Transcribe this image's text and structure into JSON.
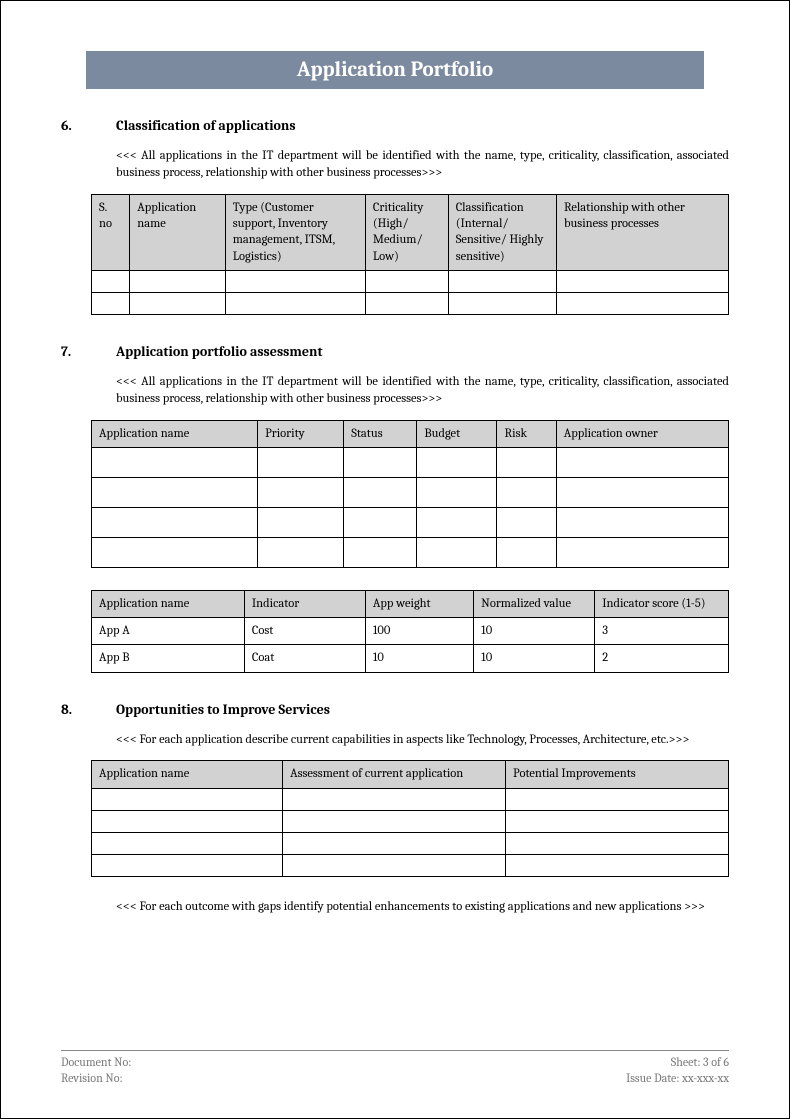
{
  "title": "Application Portfolio",
  "sections": [
    {
      "num": "6.",
      "title": "Classification of applications",
      "desc": "<<< All applications in the IT department will be identified with the name, type, criticality, classification, associated business process, relationship with other business processes>>>"
    },
    {
      "num": "7.",
      "title": "Application portfolio assessment",
      "desc": "<<< All applications in the IT department will be identified with the name, type, criticality, classification, associated business process, relationship with other business processes>>>"
    },
    {
      "num": "8.",
      "title": "Opportunities to Improve Services",
      "desc": "<<< For each application describe current capabilities in aspects like Technology, Processes, Architecture, etc.>>>"
    }
  ],
  "table1_headers": [
    "S. no",
    "Application name",
    "Type (Customer support, Inventory management, ITSM, Logistics)",
    "Criticality (High/ Medium/ Low)",
    "Classification (Internal/ Sensitive/ Highly sensitive)",
    "Relationship with other business processes"
  ],
  "table2_headers": [
    "Application name",
    "Priority",
    "Status",
    "Budget",
    "Risk",
    "Application owner"
  ],
  "table3_headers": [
    "Application name",
    "Indicator",
    "App weight",
    "Normalized value",
    "Indicator score (1-5)"
  ],
  "table3_rows": [
    [
      "App A",
      "Cost",
      "100",
      "10",
      "3"
    ],
    [
      "App B",
      "Coat",
      "10",
      "10",
      "2"
    ]
  ],
  "table4_headers": [
    "Application name",
    "Assessment of current application",
    "Potential Improvements"
  ],
  "section8_note": "<<< For each outcome with gaps identify potential enhancements to existing applications and new applications >>>",
  "footer": {
    "doc_no": "Document No:",
    "rev_no": "Revision No:",
    "sheet": "Sheet: 3 of 6",
    "issue": "Issue Date: xx-xxx-xx"
  }
}
